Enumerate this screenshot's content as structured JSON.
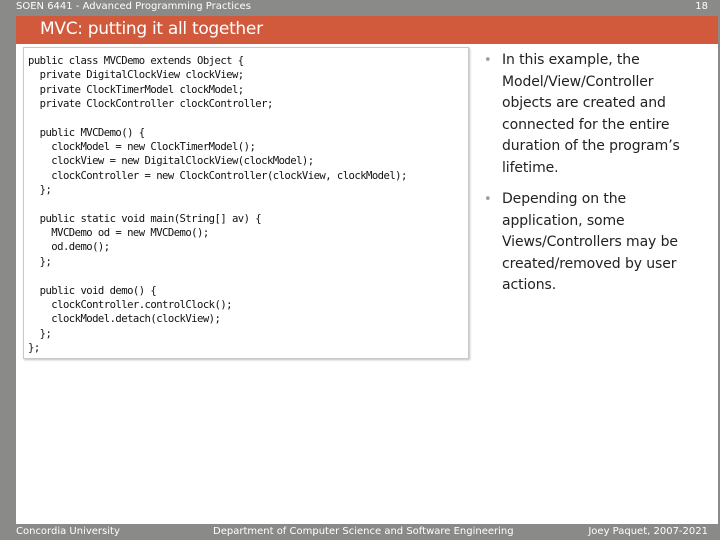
{
  "header": {
    "course": "SOEN 6441 - Advanced Programming Practices",
    "page_number": "18"
  },
  "slide": {
    "title": "MVC: putting it all together"
  },
  "code": {
    "lines": [
      "public class MVCDemo extends Object {",
      "  private DigitalClockView clockView;",
      "  private ClockTimerModel clockModel;",
      "  private ClockController clockController;",
      "",
      "  public MVCDemo() {",
      "    clockModel = new ClockTimerModel();",
      "    clockView = new DigitalClockView(clockModel);",
      "    clockController = new ClockController(clockView, clockModel);",
      "  };",
      "",
      "  public static void main(String[] av) {",
      "    MVCDemo od = new MVCDemo();",
      "    od.demo();",
      "  };",
      "",
      "  public void demo() {",
      "    clockController.controlClock();",
      "    clockModel.detach(clockView);",
      "  };",
      "};"
    ],
    "colors": {
      "code_text": "#111111"
    }
  },
  "bullets": [
    {
      "marker": "•",
      "text": "In this example, the Model/View/Controller objects are created and connected for the entire duration of the program’s lifetime."
    },
    {
      "marker": "•",
      "text": "Depending on the application, some Views/Controllers may be created/removed by user actions."
    }
  ],
  "footer": {
    "left": "Concordia University",
    "center": "Department of Computer Science and Software Engineering",
    "right": "Joey Paquet, 2007-2021"
  },
  "colors": {
    "title_bar": "#d25a3c",
    "frame": "#8a8a88",
    "slide_background": "#ffffff"
  }
}
